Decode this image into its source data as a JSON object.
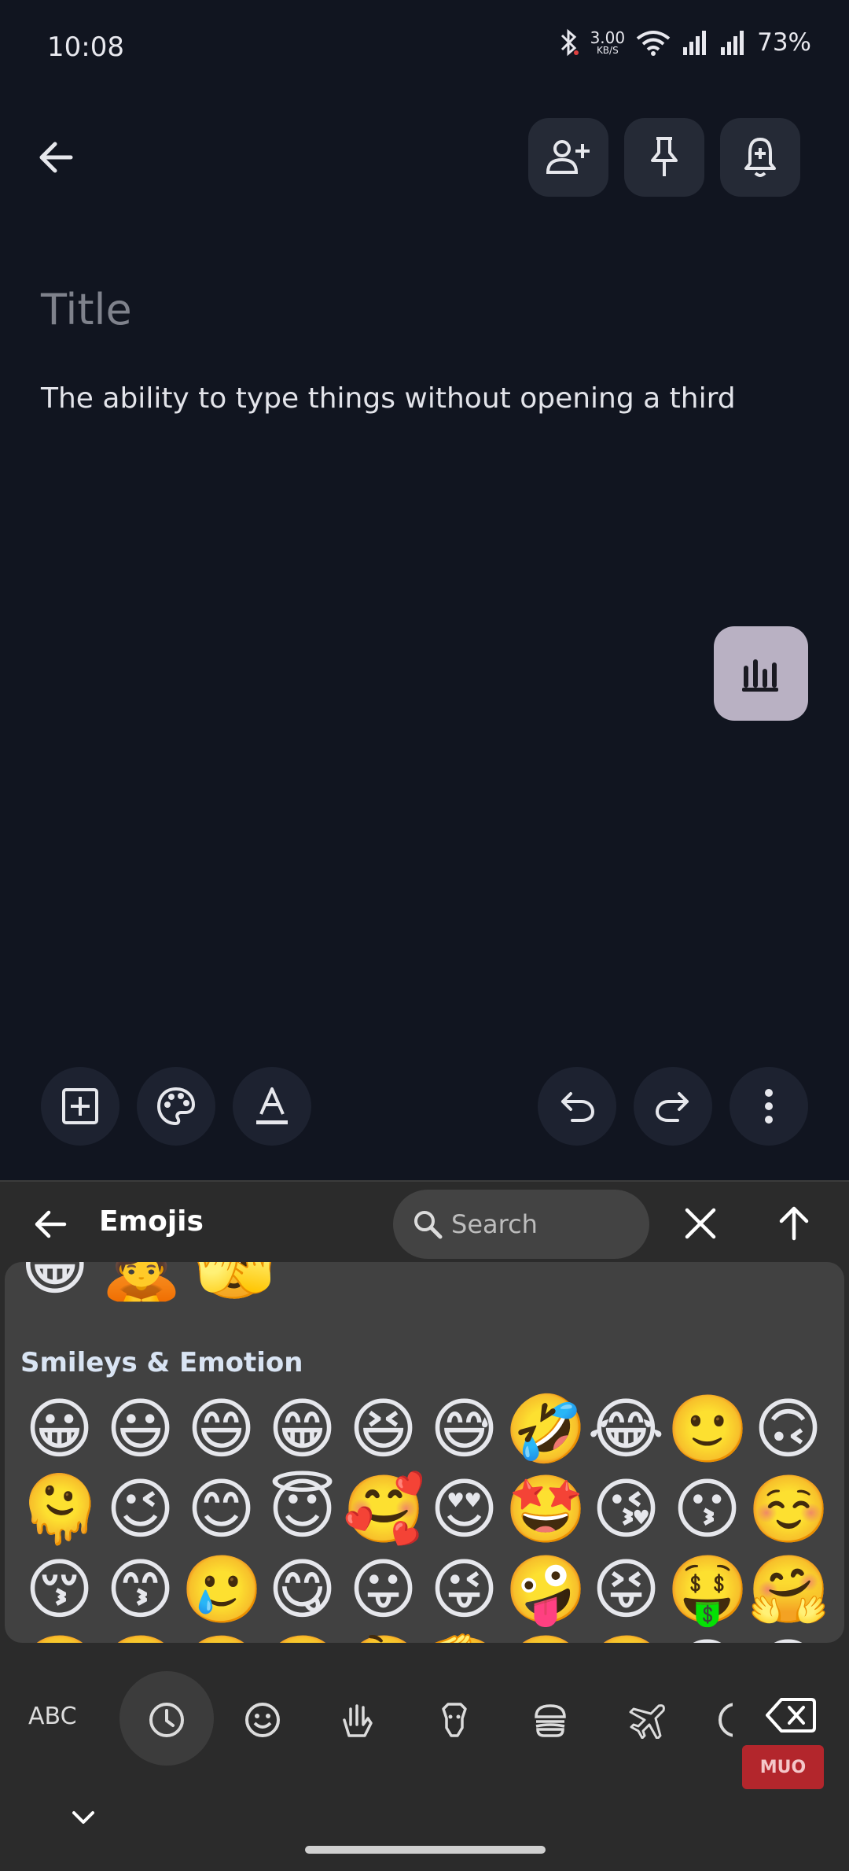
{
  "status_bar": {
    "time": "10:08",
    "speed_value": "3.00",
    "speed_unit": "KB/S",
    "battery": "73%"
  },
  "toolbar": {
    "icons": [
      "back-arrow-icon",
      "add-collaborator-icon",
      "pin-icon",
      "reminder-bell-icon"
    ]
  },
  "note": {
    "title_placeholder": "Title",
    "body": "The ability to type things without opening a third"
  },
  "note_toolbar": {
    "icons": [
      "add-box-icon",
      "palette-icon",
      "text-format-icon",
      "undo-icon",
      "redo-icon",
      "more-vert-icon"
    ]
  },
  "keyboard": {
    "header_title": "Emojis",
    "search_placeholder": "Search",
    "partial_row": [
      "😁",
      "🙇",
      "🫣"
    ],
    "section_title": "Smileys & Emotion",
    "emojis": [
      "😀",
      "😃",
      "😄",
      "😁",
      "😆",
      "😅",
      "🤣",
      "😂",
      "🙂",
      "🙃",
      "🫠",
      "😉",
      "😊",
      "😇",
      "🥰",
      "😍",
      "🤩",
      "😘",
      "😗",
      "☺️",
      "😚",
      "😙",
      "🥲",
      "😋",
      "😛",
      "😜",
      "🤪",
      "😝",
      "🤑",
      "🤗",
      "🤭",
      "🫢",
      "🫣",
      "🤫",
      "🤔",
      "🫡",
      "🤐",
      "🤨",
      "😐",
      "😑"
    ],
    "abc_label": "ABC",
    "category_icons": [
      "recent-clock-icon",
      "smiley-icon",
      "gesture-hands-icon",
      "animal-icon",
      "food-icon",
      "travel-plane-icon",
      "activity-icon"
    ],
    "watermark": "MUO",
    "colors": {
      "background": "#2b2b2b",
      "panel": "#414141",
      "accent": "#d9e4f3"
    }
  }
}
